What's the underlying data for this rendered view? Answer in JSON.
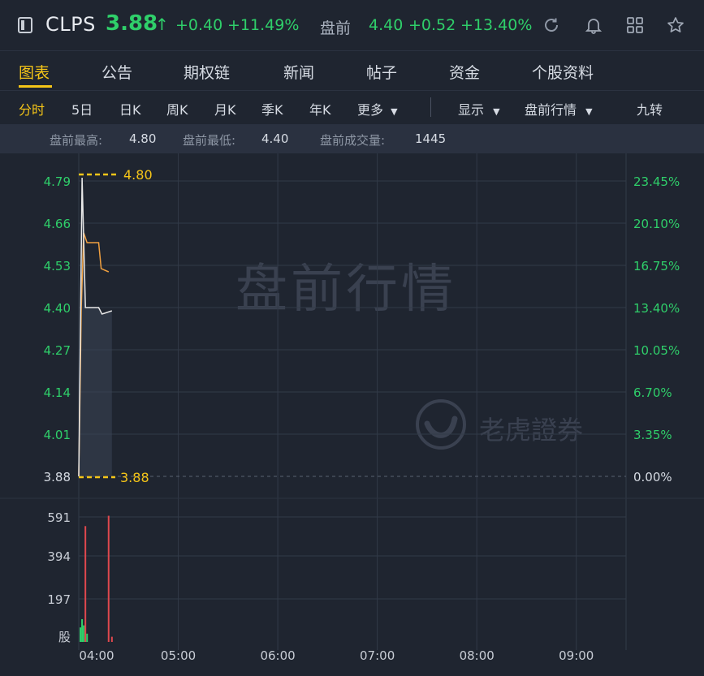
{
  "header": {
    "ticker": "CLPS",
    "price": "3.88",
    "price_arrow": "↑",
    "change": "+0.40",
    "change_pct": "+11.49%",
    "premarket_label": "盘前",
    "premarket_price": "4.40",
    "premarket_change": "+0.52",
    "premarket_change_pct": "+13.40%",
    "icons": [
      "panel-toggle-icon",
      "refresh-icon",
      "bell-icon",
      "grid-icon",
      "star-icon"
    ]
  },
  "tabs": [
    "图表",
    "公告",
    "期权链",
    "新闻",
    "帖子",
    "资金",
    "个股资料"
  ],
  "active_tab": "图表",
  "periods": {
    "items": [
      "分时",
      "5日",
      "日K",
      "周K",
      "月K",
      "季K",
      "年K",
      "更多"
    ],
    "active": "分时",
    "display": "显示",
    "premarket": "盘前行情",
    "nine_turn": "九转"
  },
  "info_bar": {
    "high_label": "盘前最高:",
    "high_value": "4.80",
    "low_label": "盘前最低:",
    "low_value": "4.40",
    "volume_label": "盘前成交量:",
    "volume_value": "1445"
  },
  "watermark": "盘前行情",
  "brand": "老虎證券",
  "colors": {
    "up": "#2fcf6a",
    "accent": "#f5c518",
    "price_line": "#e8e8e8",
    "avg_line": "#f0a040",
    "vol_up": "#e0484e",
    "vol_down": "#2fcf6a"
  },
  "chart_data": {
    "type": "line",
    "y_left_ticks": [
      "4.79",
      "4.66",
      "4.53",
      "4.40",
      "4.27",
      "4.14",
      "4.01",
      "3.88"
    ],
    "y_right_ticks": [
      "23.45%",
      "20.10%",
      "16.75%",
      "13.40%",
      "10.05%",
      "6.70%",
      "3.35%",
      "0.00%"
    ],
    "ylim": [
      3.88,
      4.8
    ],
    "x_ticks": [
      "04:00",
      "05:00",
      "06:00",
      "07:00",
      "08:00",
      "09:00"
    ],
    "high_marker": "4.80",
    "base_marker": "3.88",
    "series": [
      {
        "kind": "price",
        "points": [
          [
            0.0,
            3.88
          ],
          [
            2.0,
            4.8
          ],
          [
            4.0,
            4.4
          ],
          [
            12.0,
            4.4
          ],
          [
            14.0,
            4.38
          ],
          [
            20.0,
            4.39
          ]
        ]
      },
      {
        "kind": "average",
        "points": [
          [
            0.0,
            3.88
          ],
          [
            1.5,
            4.4
          ],
          [
            3.0,
            4.63
          ],
          [
            5.0,
            4.6
          ],
          [
            9.0,
            4.6
          ],
          [
            12.0,
            4.6
          ],
          [
            13.5,
            4.52
          ],
          [
            18.0,
            4.51
          ]
        ]
      }
    ],
    "volume": {
      "y_ticks": [
        "591",
        "394",
        "197",
        "股"
      ],
      "ymax": 620,
      "bars": [
        {
          "t": 1,
          "v": 70,
          "dir": "down"
        },
        {
          "t": 2,
          "v": 110,
          "dir": "down"
        },
        {
          "t": 3,
          "v": 80,
          "dir": "down"
        },
        {
          "t": 4,
          "v": 560,
          "dir": "up"
        },
        {
          "t": 5,
          "v": 40,
          "dir": "down"
        },
        {
          "t": 18,
          "v": 610,
          "dir": "up"
        },
        {
          "t": 20,
          "v": 25,
          "dir": "up"
        }
      ]
    }
  }
}
